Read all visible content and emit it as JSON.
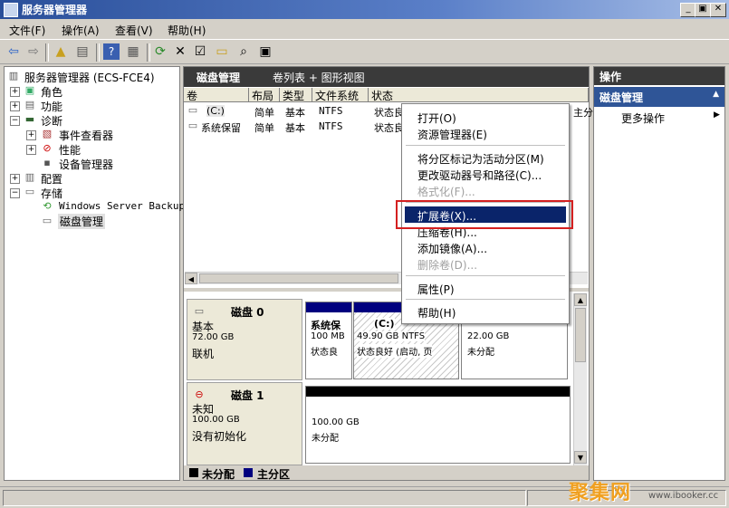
{
  "window": {
    "title": "服务器管理器"
  },
  "window_buttons": {
    "minimize": "_",
    "restore": "▣",
    "close": "✕"
  },
  "menu": [
    "文件(F)",
    "操作(A)",
    "查看(V)",
    "帮助(H)"
  ],
  "tree": {
    "root": "服务器管理器 (ECS-FCE4)",
    "roles": "角色",
    "features": "功能",
    "diagnostics": "诊断",
    "event_viewer": "事件查看器",
    "performance": "性能",
    "device_manager": "设备管理器",
    "configuration": "配置",
    "storage": "存储",
    "backup": "Windows Server Backup",
    "disk_management": "磁盘管理"
  },
  "center": {
    "title": "磁盘管理",
    "view": "卷列表 + 图形视图",
    "columns": [
      "卷",
      "布局",
      "类型",
      "文件系统",
      "状态"
    ],
    "rows": [
      [
        "(C:)",
        "简单",
        "基本",
        "NTFS",
        "状态良"
      ],
      [
        "系统保留",
        "简单",
        "基本",
        "NTFS",
        "状态良"
      ]
    ],
    "row0_tail": "良好 (启动, 页面文件, 故障转储, 主分",
    "row0_tail_right": "主分"
  },
  "disks": {
    "disk0": {
      "name": "磁盘 0",
      "type": "基本",
      "size": "72.00 GB",
      "status": "联机",
      "p1": {
        "name": "系统保",
        "size": "100 MB",
        "status": "状态良"
      },
      "p2": {
        "name": "(C:)",
        "size": "49.90 GB NTFS",
        "status": "状态良好 (启动, 页"
      },
      "p3": {
        "size": "22.00 GB",
        "status": "未分配"
      }
    },
    "disk1": {
      "name": "磁盘 1",
      "type": "未知",
      "size": "100.00 GB",
      "status": "没有初始化",
      "p1": {
        "size": "100.00 GB",
        "status": "未分配"
      }
    }
  },
  "legend": {
    "unallocated": "未分配",
    "primary": "主分区"
  },
  "actions": {
    "header": "操作",
    "section": "磁盘管理",
    "more": "更多操作"
  },
  "context_menu": {
    "open": "打开(O)",
    "explorer": "资源管理器(E)",
    "mark_active": "将分区标记为活动分区(M)",
    "change_letter": "更改驱动器号和路径(C)...",
    "format": "格式化(F)...",
    "extend": "扩展卷(X)...",
    "shrink": "压缩卷(H)...",
    "mirror": "添加镜像(A)...",
    "delete": "删除卷(D)...",
    "properties": "属性(P)",
    "help": "帮助(H)"
  },
  "watermark": {
    "brand": "聚集网",
    "url": "www.ibooker.cc"
  },
  "colors": {
    "primary_partition": "#00007f",
    "unallocated": "#000000",
    "highlight": "#0a246a",
    "annotation": "#d42020"
  }
}
